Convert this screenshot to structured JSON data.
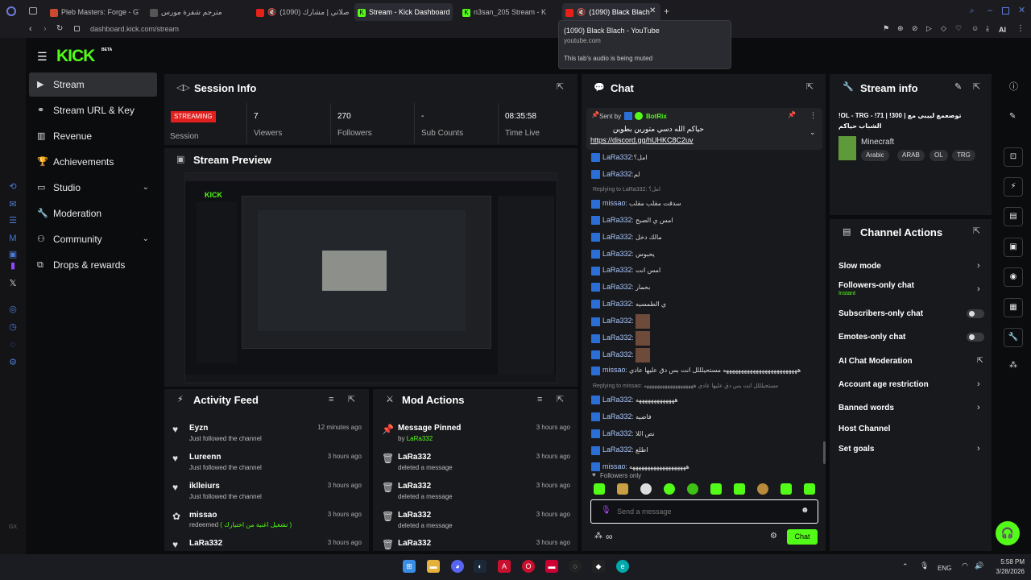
{
  "browser": {
    "tabs": [
      {
        "label": "Pleb Masters: Forge - GTA"
      },
      {
        "label": "مترجم شفرة مورس"
      },
      {
        "label": "(1090) إلا صلاتي | مشارك"
      },
      {
        "label": "Stream - Kick Dashboard"
      },
      {
        "label": "n3san_205 Stream - K"
      },
      {
        "label": "(1090) Black Blach"
      }
    ],
    "url_host": "dashboard.kick.com",
    "url_path": "/stream",
    "tooltip": {
      "title": "(1090) Black Blach - YouTube",
      "domain": "youtube.com",
      "note": "This tab's audio is being muted"
    },
    "ai_label": "AI"
  },
  "nav": {
    "logo": "KICK",
    "logo_sup": "BETA",
    "items": [
      {
        "label": "Stream"
      },
      {
        "label": "Stream URL & Key"
      },
      {
        "label": "Revenue"
      },
      {
        "label": "Achievements"
      },
      {
        "label": "Studio"
      },
      {
        "label": "Moderation"
      },
      {
        "label": "Community"
      },
      {
        "label": "Drops & rewards"
      }
    ]
  },
  "session": {
    "title": "Session Info",
    "status": "STREAMING",
    "session_label": "Session",
    "stats": [
      {
        "value": "7",
        "label": "Viewers"
      },
      {
        "value": "270",
        "label": "Followers"
      },
      {
        "value": "-",
        "label": "Sub Counts"
      },
      {
        "value": "08:35:58",
        "label": "Time Live"
      }
    ]
  },
  "preview": {
    "title": "Stream Preview"
  },
  "activity": {
    "title": "Activity Feed",
    "items": [
      {
        "name": "Eyzn",
        "action": "Just followed the channel",
        "time": "12 minutes ago",
        "icon": "heart-icon"
      },
      {
        "name": "Lureenn",
        "action": "Just followed the channel",
        "time": "3 hours ago",
        "icon": "heart-icon"
      },
      {
        "name": "iklleiurs",
        "action": "Just followed the channel",
        "time": "3 hours ago",
        "icon": "heart-icon"
      },
      {
        "name": "missao",
        "action": "redeemed",
        "reward": "( تشغيل اغنية من اختيارك )",
        "time": "3 hours ago",
        "icon": "gift-icon"
      },
      {
        "name": "LaRa332",
        "action": "",
        "time": "3 hours ago",
        "icon": "heart-icon"
      }
    ]
  },
  "mod": {
    "title": "Mod Actions",
    "items": [
      {
        "name": "Message Pinned",
        "sub_prefix": "by",
        "sub_user": "LaRa332",
        "time": "3 hours ago",
        "icon": "pin-icon"
      },
      {
        "name": "LaRa332",
        "sub": "deleted a message",
        "time": "3 hours ago",
        "icon": "trash-icon"
      },
      {
        "name": "LaRa332",
        "sub": "deleted a message",
        "time": "3 hours ago",
        "icon": "trash-icon"
      },
      {
        "name": "LaRa332",
        "sub": "deleted a message",
        "time": "3 hours ago",
        "icon": "trash-icon"
      },
      {
        "name": "LaRa332",
        "sub": "",
        "time": "3 hours ago",
        "icon": "trash-icon"
      }
    ]
  },
  "chat": {
    "title": "Chat",
    "pinned": {
      "sent_by": "Sent by",
      "user": "BotRix",
      "text": "حياكم الله دسي متورين بطوين",
      "link": "https://discord.gg/hUHKC8C2uv"
    },
    "messages": [
      {
        "user": "LaRa332",
        "text": ":امل؟"
      },
      {
        "user": "LaRa332",
        "text": ":لم"
      },
      {
        "reply": "Replying to LaRa332: امل؟"
      },
      {
        "user": "missao",
        "text": ": سدقت مقلب مقلب"
      },
      {
        "user": "LaRa332",
        "text": ": امس ي الصبح"
      },
      {
        "user": "LaRa332",
        "text": ": مالك دخل"
      },
      {
        "user": "LaRa332",
        "text": ": يحبوس"
      },
      {
        "user": "LaRa332",
        "text": ": امس انت"
      },
      {
        "user": "LaRa332",
        "text": ": بحمار"
      },
      {
        "user": "LaRa332",
        "text": ": ي الطمسيه"
      },
      {
        "user": "LaRa332",
        "text": ":",
        "emote": true
      },
      {
        "user": "LaRa332",
        "text": ":",
        "emote": true
      },
      {
        "user": "LaRa332",
        "text": ":",
        "emote": true
      },
      {
        "user": "missao",
        "text": ": هههههههههههههههههههههههههه مستحيلللل انت بس دق عليها عادي"
      },
      {
        "reply": "Replying to missao: مستحيلللل انت بس دق عليها عادي هههههههههههههههههههه"
      },
      {
        "user": "LaRa332",
        "text": ": هههههههههههههه"
      },
      {
        "user": "LaRa332",
        "text": ": فاضيه"
      },
      {
        "user": "LaRa332",
        "text": ": نص اللا"
      },
      {
        "user": "LaRa332",
        "text": ": اطلع"
      },
      {
        "user": "missao",
        "text": ": هههههههههههههههههههه"
      }
    ],
    "followers_only": "Followers only",
    "placeholder": "Send a message",
    "send_label": "Chat"
  },
  "stream_info": {
    "title": "Stream info",
    "stream_title": "!OL - TRG - !71 | !300 | توصعمع لييبي مع",
    "stream_title2": "الشباب حياكم",
    "category": "Minecraft",
    "tags": [
      "Arabic",
      "ARAB",
      "OL",
      "TRG"
    ]
  },
  "channel_actions": {
    "title": "Channel Actions",
    "items": [
      {
        "label": "Slow mode"
      },
      {
        "label": "Followers-only chat",
        "sub": "Instant"
      },
      {
        "label": "Subscribers-only chat"
      },
      {
        "label": "Emotes-only chat"
      },
      {
        "label": "AI Chat Moderation"
      },
      {
        "label": "Account age restriction"
      },
      {
        "label": "Banned words"
      },
      {
        "label": "Host Channel"
      },
      {
        "label": "Set goals"
      }
    ]
  },
  "taskbar": {
    "lang": "ENG",
    "time": "5:58 PM",
    "date": "3/28/2026"
  },
  "colors": {
    "accent": "#53fc18",
    "panel": "#18191c",
    "bg": "#0b0c0e",
    "link": "#a9c7ff",
    "streaming": "#e21f1f"
  }
}
